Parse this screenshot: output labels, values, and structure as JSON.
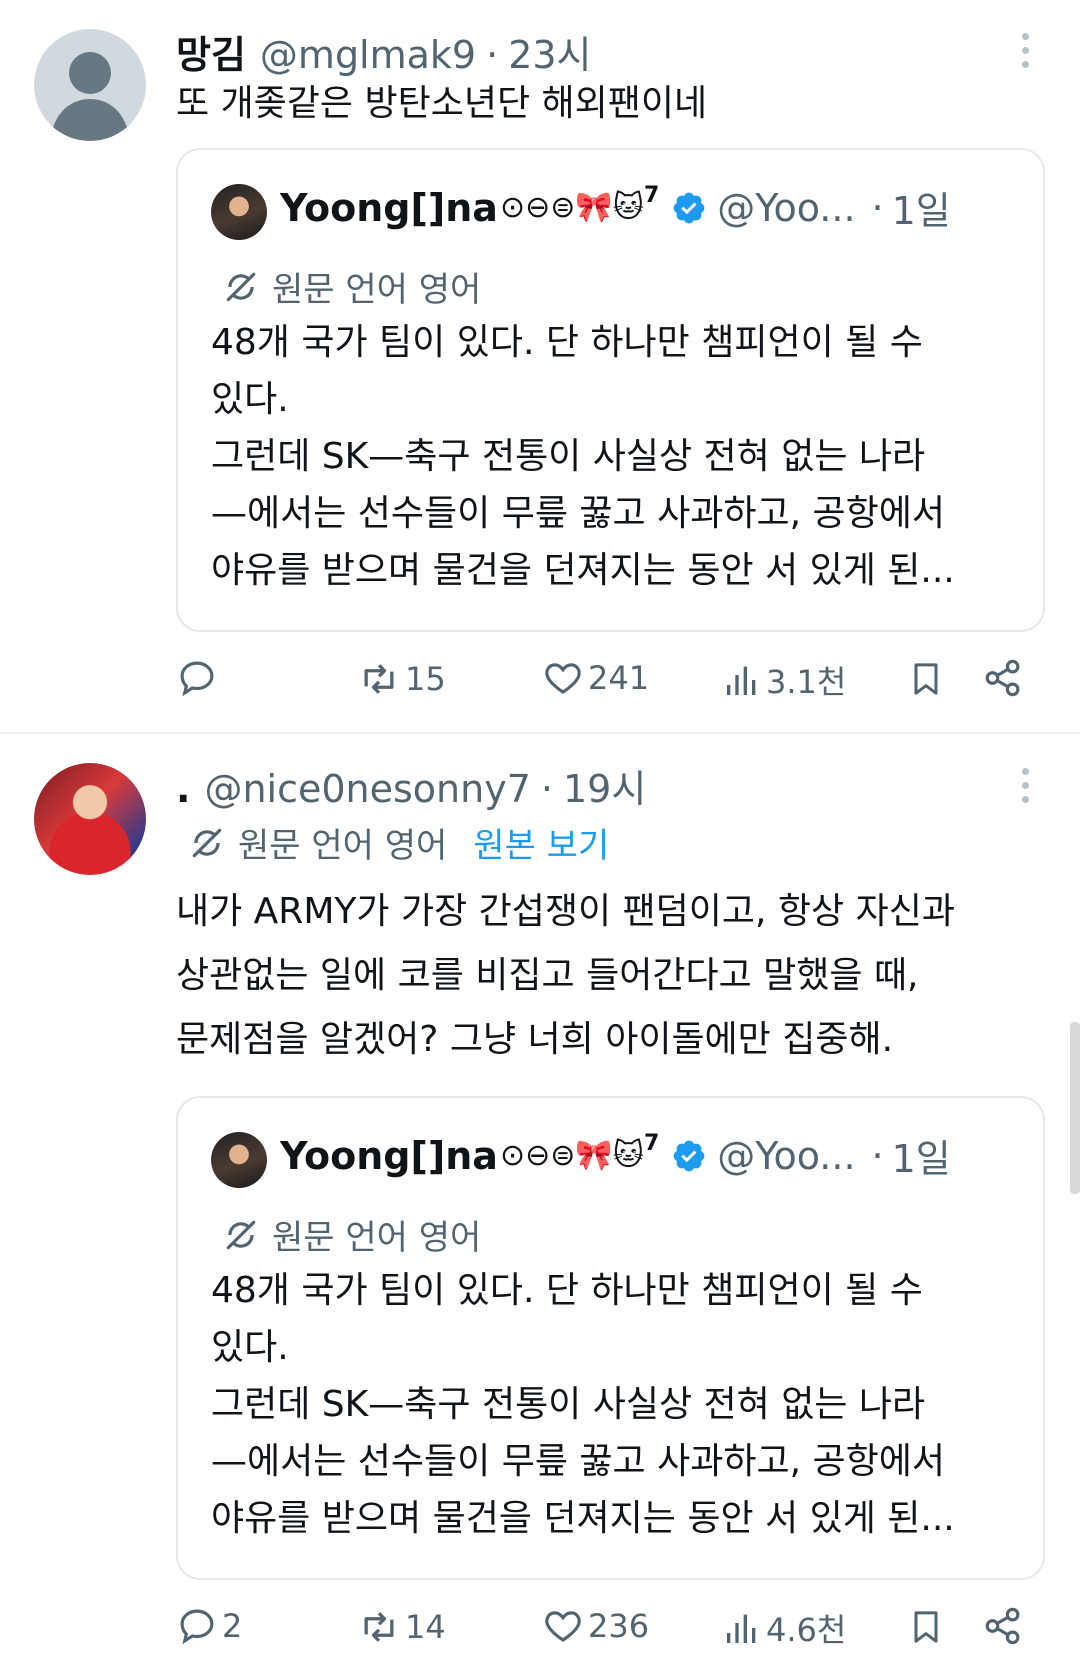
{
  "tweets": [
    {
      "display_name": "망김",
      "handle": "@mglmak9",
      "separator": "·",
      "time": "23시",
      "text_lines": [
        "또 개좆같은 방탄소년단 해외팬이네"
      ],
      "translation_label": "",
      "view_original": "",
      "quote": {
        "display_name": "Yoong[]na",
        "name_emoji": "⊙⊖⊜🎀🐱",
        "name_sup": "7",
        "handle": "@Yoo...",
        "separator": "·",
        "time": "1일",
        "translation_label": "원문 언어 영어",
        "text_lines": [
          "48개 국가 팀이 있다. 단 하나만 챔피언이 될 수",
          "있다.",
          "그런데 SK—축구 전통이 사실상 전혀 없는 나라",
          "—에서는 선수들이 무릎 꿇고 사과하고, 공항에서",
          "야유를 받으며 물건을 던져지는 동안 서 있게 된..."
        ]
      },
      "actions": {
        "replies": "",
        "retweets": "15",
        "likes": "241",
        "views": "3.1천"
      }
    },
    {
      "display_name": ".",
      "handle": "@nice0nesonny7",
      "separator": "·",
      "time": "19시",
      "translation_label": "원문 언어 영어",
      "view_original": "원본 보기",
      "text_lines": [
        "내가 ARMY가 가장 간섭쟁이 팬덤이고, 항상 자신과",
        "상관없는 일에 코를 비집고 들어간다고 말했을 때,",
        "문제점을 알겠어? 그냥 너희 아이돌에만 집중해."
      ],
      "quote": {
        "display_name": "Yoong[]na",
        "name_emoji": "⊙⊖⊜🎀🐱",
        "name_sup": "7",
        "handle": "@Yoo...",
        "separator": "·",
        "time": "1일",
        "translation_label": "원문 언어 영어",
        "text_lines": [
          "48개 국가 팀이 있다. 단 하나만 챔피언이 될 수",
          "있다.",
          "그런데 SK—축구 전통이 사실상 전혀 없는 나라",
          "—에서는 선수들이 무릎 꿇고 사과하고, 공항에서",
          "야유를 받으며 물건을 던져지는 동안 서 있게 된..."
        ]
      },
      "actions": {
        "replies": "2",
        "retweets": "14",
        "likes": "236",
        "views": "4.6천"
      }
    }
  ],
  "icons": {
    "reply": "speech-bubble-icon",
    "retweet": "retweet-arrows-icon",
    "like": "heart-icon",
    "views": "bar-chart-icon",
    "bookmark": "bookmark-icon",
    "share": "share-nodes-icon",
    "translate": "translate-icon",
    "verified": "verified-badge-icon",
    "more": "more-vertical-icon"
  },
  "colors": {
    "text": "#0f1419",
    "muted": "#536471",
    "link": "#1d9bf0",
    "verified": "#1d9bf0",
    "border": "#e4e9ec"
  }
}
